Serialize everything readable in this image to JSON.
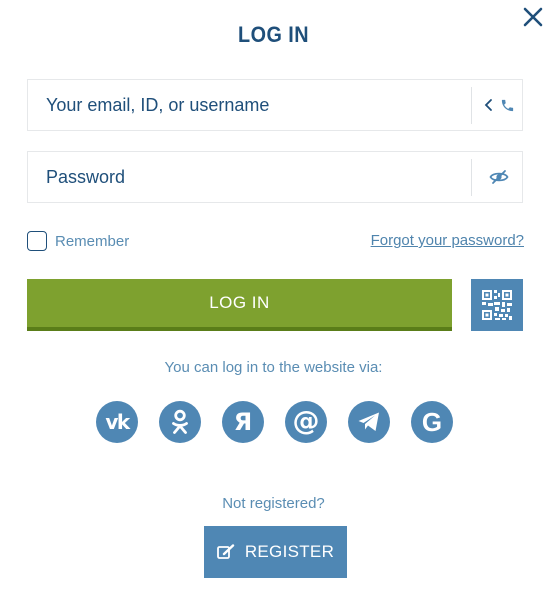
{
  "modal": {
    "title": "LOG IN",
    "close_icon": "close-icon"
  },
  "form": {
    "login_placeholder": "Your email, ID, or username",
    "login_value": "",
    "login_mode_icons": [
      "chevron-left-icon",
      "phone-icon"
    ],
    "password_placeholder": "Password",
    "password_value": "",
    "password_toggle_icon": "eye-slash-icon",
    "remember_label": "Remember",
    "remember_checked": false,
    "forgot_label": "Forgot your password?",
    "login_button": "LOG IN",
    "qr_icon": "qr-code-icon"
  },
  "social": {
    "caption": "You can log in to the website via:",
    "providers": [
      {
        "name": "VK",
        "icon": "vk-icon",
        "glyph": "vk"
      },
      {
        "name": "Odnoklassniki",
        "icon": "odnoklassniki-icon",
        "glyph": ""
      },
      {
        "name": "Yandex",
        "icon": "yandex-icon",
        "glyph": "Я"
      },
      {
        "name": "Mail.ru",
        "icon": "mail-ru-icon",
        "glyph": "@"
      },
      {
        "name": "Telegram",
        "icon": "telegram-icon",
        "glyph": ""
      },
      {
        "name": "Google",
        "icon": "google-icon",
        "glyph": "G"
      }
    ]
  },
  "register": {
    "caption": "Not registered?",
    "button": "REGISTER",
    "icon": "edit-icon"
  },
  "colors": {
    "primary_dark": "#1f4f7a",
    "accent_blue": "#4f87b4",
    "link_blue": "#5a8db3",
    "login_green": "#7ea12f",
    "login_green_shadow": "#5a7d19",
    "border": "#e6e8ea",
    "background": "#ffffff"
  }
}
